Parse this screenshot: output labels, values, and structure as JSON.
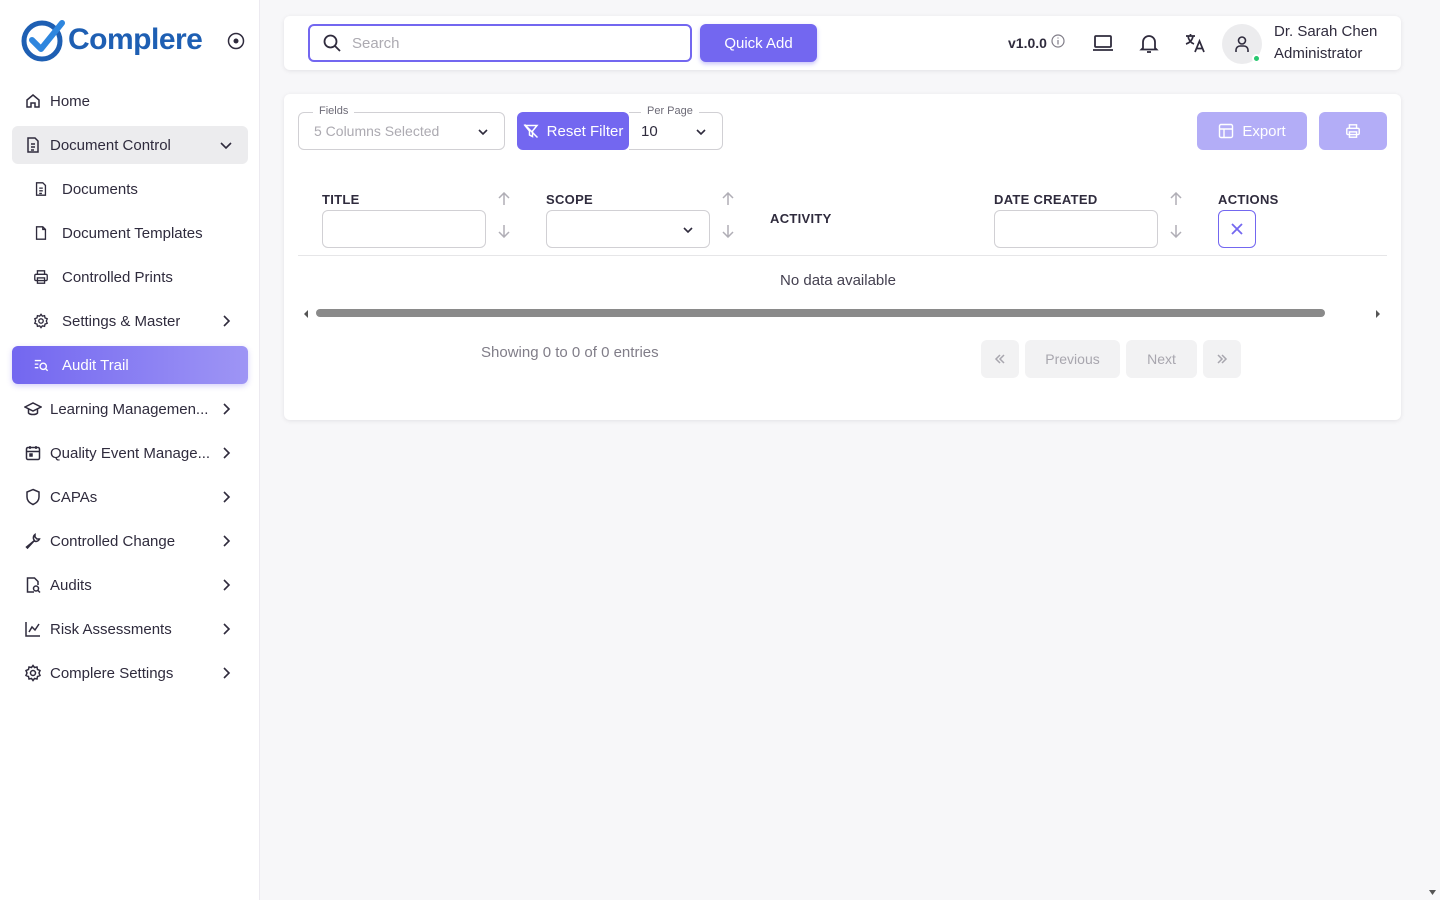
{
  "brand": {
    "name": "Complere"
  },
  "sidebar": {
    "items": [
      {
        "label": "Home",
        "icon": "home-icon"
      },
      {
        "label": "Document Control",
        "icon": "document-icon",
        "expanded": true
      },
      {
        "label": "Documents",
        "icon": "document-icon",
        "sub": true
      },
      {
        "label": "Document Templates",
        "icon": "file-icon",
        "sub": true
      },
      {
        "label": "Controlled Prints",
        "icon": "printer-icon",
        "sub": true
      },
      {
        "label": "Settings & Master",
        "icon": "gear-icon",
        "sub": true
      },
      {
        "label": "Audit Trail",
        "icon": "search-list-icon",
        "sub": true,
        "active": true
      },
      {
        "label": "Learning Managemen...",
        "icon": "graduation-cap-icon"
      },
      {
        "label": "Quality Event Manage...",
        "icon": "calendar-icon"
      },
      {
        "label": "CAPAs",
        "icon": "shield-icon"
      },
      {
        "label": "Controlled Change",
        "icon": "wrench-icon"
      },
      {
        "label": "Audits",
        "icon": "file-search-icon"
      },
      {
        "label": "Risk Assessments",
        "icon": "chart-line-icon"
      },
      {
        "label": "Complere Settings",
        "icon": "gear-icon"
      }
    ]
  },
  "topbar": {
    "search_placeholder": "Search",
    "quick_add": "Quick Add",
    "version": "v1.0.0",
    "user_name": "Dr. Sarah Chen",
    "user_role": "Administrator"
  },
  "filters": {
    "fields_label": "Fields",
    "fields_value": "5 Columns Selected",
    "reset_filter": "Reset Filter",
    "per_page_label": "Per Page",
    "per_page_value": "10",
    "export": "Export"
  },
  "table": {
    "columns": [
      "TITLE",
      "SCOPE",
      "ACTIVITY",
      "DATE CREATED",
      "ACTIONS"
    ],
    "empty_message": "No data available",
    "showing": "Showing 0 to 0 of 0 entries"
  },
  "pagination": {
    "previous": "Previous",
    "next": "Next"
  },
  "colors": {
    "primary": "#7367f0",
    "primary_light": "#b3adf7",
    "online": "#28c76f",
    "brand": "#1e5fb3"
  }
}
